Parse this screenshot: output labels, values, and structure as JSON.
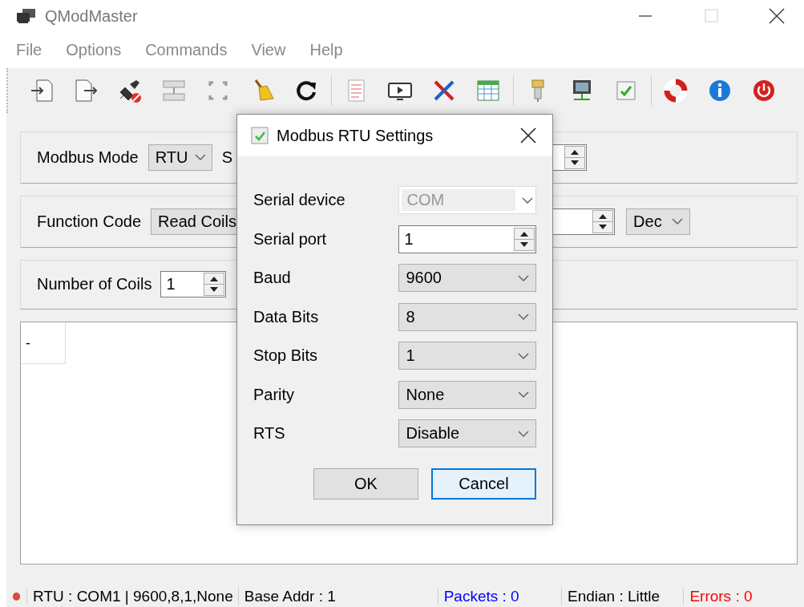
{
  "window": {
    "title": "QModMaster"
  },
  "menu": [
    "File",
    "Options",
    "Commands",
    "View",
    "Help"
  ],
  "rows": [
    {
      "items": [
        {
          "kind": "label",
          "text": "Modbus Mode"
        },
        {
          "kind": "combo",
          "value": "RTU"
        },
        {
          "kind": "label",
          "text": "S"
        },
        {
          "kind": "spin"
        }
      ]
    },
    {
      "items": [
        {
          "kind": "label",
          "text": "Function Code"
        },
        {
          "kind": "combo",
          "value": "Read Coils"
        },
        {
          "kind": "spin"
        },
        {
          "kind": "combo",
          "value": "Dec"
        }
      ]
    },
    {
      "items": [
        {
          "kind": "label",
          "text": "Number of Coils"
        },
        {
          "kind": "spin",
          "value": "1"
        }
      ]
    }
  ],
  "output": {
    "cells": [
      "-"
    ]
  },
  "status_bar": [
    {
      "text": "RTU : COM1 | 9600,8,1,None",
      "color": "#000000"
    },
    {
      "text": "Base Addr : 1",
      "color": "#000000"
    },
    {
      "text": "Packets : 0",
      "color": "#0000ff"
    },
    {
      "text": "Endian : Little",
      "color": "#000000"
    },
    {
      "text": "Errors : 0",
      "color": "#ff0000"
    }
  ],
  "dialog": {
    "title": "Modbus RTU Settings",
    "fields": [
      {
        "label": "Serial device",
        "kind": "combo",
        "value": "COM",
        "disabled": true
      },
      {
        "label": "Serial port",
        "kind": "spin",
        "value": "1",
        "disabled": false
      },
      {
        "label": "Baud",
        "kind": "combo",
        "value": "9600",
        "disabled": false
      },
      {
        "label": "Data Bits",
        "kind": "combo",
        "value": "8",
        "disabled": false
      },
      {
        "label": "Stop Bits",
        "kind": "combo",
        "value": "1",
        "disabled": false
      },
      {
        "label": "Parity",
        "kind": "combo",
        "value": "None",
        "disabled": false
      },
      {
        "label": "RTS",
        "kind": "combo",
        "value": "Disable",
        "disabled": false
      }
    ],
    "buttons": [
      {
        "label": "OK",
        "focused": false
      },
      {
        "label": "Cancel",
        "focused": true
      }
    ]
  }
}
